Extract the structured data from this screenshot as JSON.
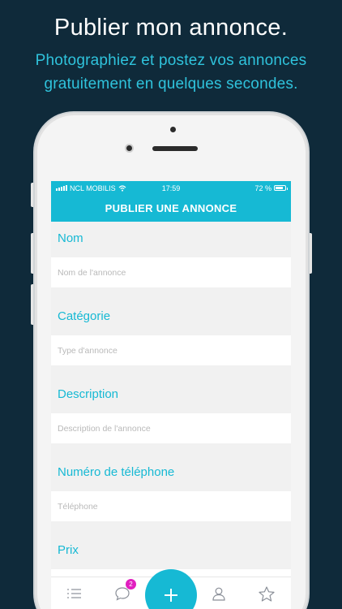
{
  "promo": {
    "headline": "Publier mon annonce.",
    "subline_1": "Photographiez et postez vos annonces",
    "subline_2": "gratuitement en quelques secondes."
  },
  "status_bar": {
    "carrier": "NCL MOBILIS",
    "time": "17:59",
    "battery": "72 %"
  },
  "nav": {
    "title": "PUBLIER UNE ANNONCE"
  },
  "form": {
    "fields": [
      {
        "label": "Nom",
        "placeholder": "Nom de l'annonce",
        "value": ""
      },
      {
        "label": "Catégorie",
        "placeholder": "Type d'annonce",
        "value": ""
      },
      {
        "label": "Description",
        "placeholder": "Description de l'annonce",
        "value": ""
      },
      {
        "label": "Numéro de téléphone",
        "placeholder": "Téléphone",
        "value": ""
      },
      {
        "label": "Prix",
        "placeholder": "",
        "value": ""
      }
    ]
  },
  "tabbar": {
    "items": [
      {
        "icon": "list-icon"
      },
      {
        "icon": "chat-bubble-icon",
        "badge": "2"
      },
      {
        "icon": "plus-icon"
      },
      {
        "icon": "user-icon"
      },
      {
        "icon": "star-icon"
      }
    ]
  },
  "colors": {
    "background": "#0f2a3a",
    "accent": "#16b9d4",
    "badge": "#e11fbf"
  }
}
